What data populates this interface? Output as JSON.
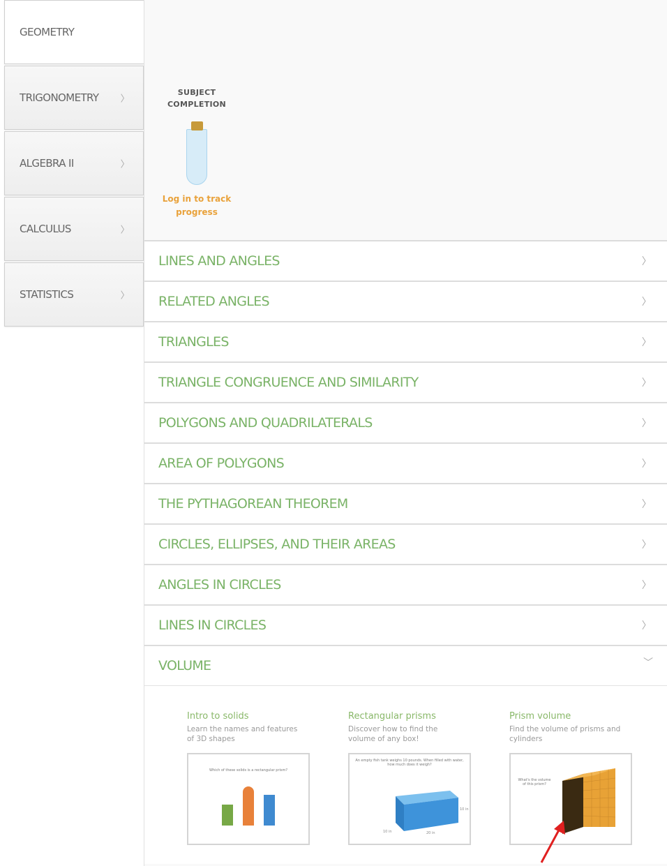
{
  "sidebar": {
    "items": [
      {
        "label": "GEOMETRY",
        "chevron": ""
      },
      {
        "label": "TRIGONOMETRY",
        "chevron": "〉"
      },
      {
        "label": "ALGEBRA II",
        "chevron": "〉"
      },
      {
        "label": "CALCULUS",
        "chevron": "〉"
      },
      {
        "label": "STATISTICS",
        "chevron": "〉"
      }
    ]
  },
  "completion": {
    "title_line1": "SUBJECT",
    "title_line2": "COMPLETION",
    "login_line1": "Log in to track",
    "login_line2": "progress",
    "colors": {
      "cork": "#c79a3a",
      "tube": "#d7ecf8",
      "login": "#e9a23b"
    }
  },
  "topics": {
    "chevron": "〉",
    "open_chevron": "〉",
    "items": [
      "LINES AND ANGLES",
      "RELATED ANGLES",
      "TRIANGLES",
      "TRIANGLE CONGRUENCE AND SIMILARITY",
      "POLYGONS AND QUADRILATERALS",
      "AREA OF POLYGONS",
      "THE PYTHAGOREAN THEOREM",
      "CIRCLES, ELLIPSES, AND THEIR AREAS",
      "ANGLES IN CIRCLES",
      "LINES IN CIRCLES",
      "VOLUME"
    ],
    "accent_color": "#7ab367"
  },
  "skills": [
    {
      "title": "Intro to solids",
      "desc_line1": "Learn the names and features",
      "desc_line2": "of 3D shapes",
      "caption": "Which of these solids is a rectangular prism?"
    },
    {
      "title": "Rectangular prisms",
      "desc_line1": "Discover how to find the",
      "desc_line2": "volume of any box!",
      "caption": "An empty fish tank weighs 10 pounds. When filled with water, how much does it weigh?",
      "dim_front": "10 in",
      "dim_side": "20 in",
      "dim_height": "10 in"
    },
    {
      "title": "Prism volume",
      "desc_line1": "Find the volume of prisms and",
      "desc_line2": "cylinders",
      "caption_line1": "What's the volume",
      "caption_line2": "of this prism?"
    }
  ]
}
